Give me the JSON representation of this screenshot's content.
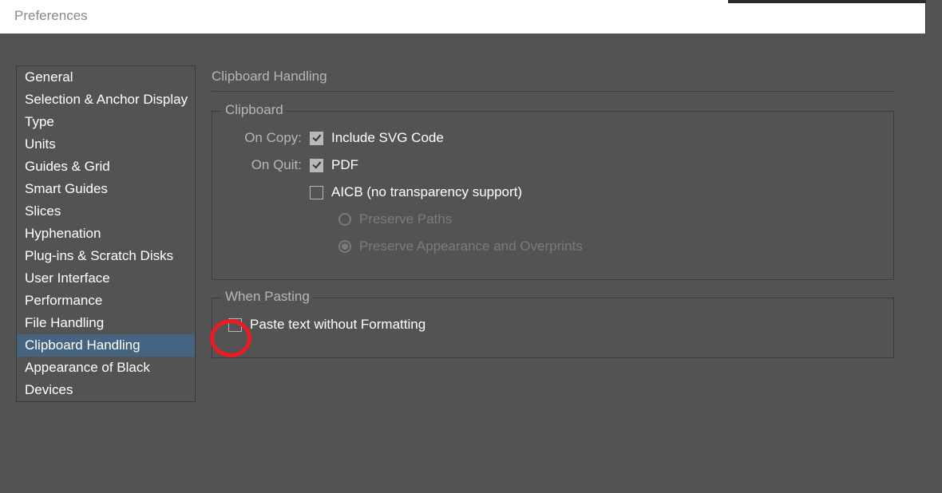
{
  "window": {
    "title": "Preferences"
  },
  "sidebar": {
    "items": [
      {
        "label": "General",
        "selected": false
      },
      {
        "label": "Selection & Anchor Display",
        "selected": false
      },
      {
        "label": "Type",
        "selected": false
      },
      {
        "label": "Units",
        "selected": false
      },
      {
        "label": "Guides & Grid",
        "selected": false
      },
      {
        "label": "Smart Guides",
        "selected": false
      },
      {
        "label": "Slices",
        "selected": false
      },
      {
        "label": "Hyphenation",
        "selected": false
      },
      {
        "label": "Plug-ins & Scratch Disks",
        "selected": false
      },
      {
        "label": "User Interface",
        "selected": false
      },
      {
        "label": "Performance",
        "selected": false
      },
      {
        "label": "File Handling",
        "selected": false
      },
      {
        "label": "Clipboard Handling",
        "selected": true
      },
      {
        "label": "Appearance of Black",
        "selected": false
      },
      {
        "label": "Devices",
        "selected": false
      }
    ]
  },
  "panel": {
    "title": "Clipboard Handling",
    "clipboard": {
      "legend": "Clipboard",
      "on_copy_label": "On Copy:",
      "on_quit_label": "On Quit:",
      "include_svg": {
        "label": "Include SVG Code",
        "checked": true
      },
      "pdf": {
        "label": "PDF",
        "checked": true
      },
      "aicb": {
        "label": "AICB (no transparency support)",
        "checked": false
      },
      "preserve_paths": {
        "label": "Preserve Paths",
        "selected": false
      },
      "preserve_appearance": {
        "label": "Preserve Appearance and Overprints",
        "selected": true
      }
    },
    "pasting": {
      "legend": "When Pasting",
      "paste_text": {
        "label": "Paste text without Formatting",
        "checked": false
      }
    }
  }
}
